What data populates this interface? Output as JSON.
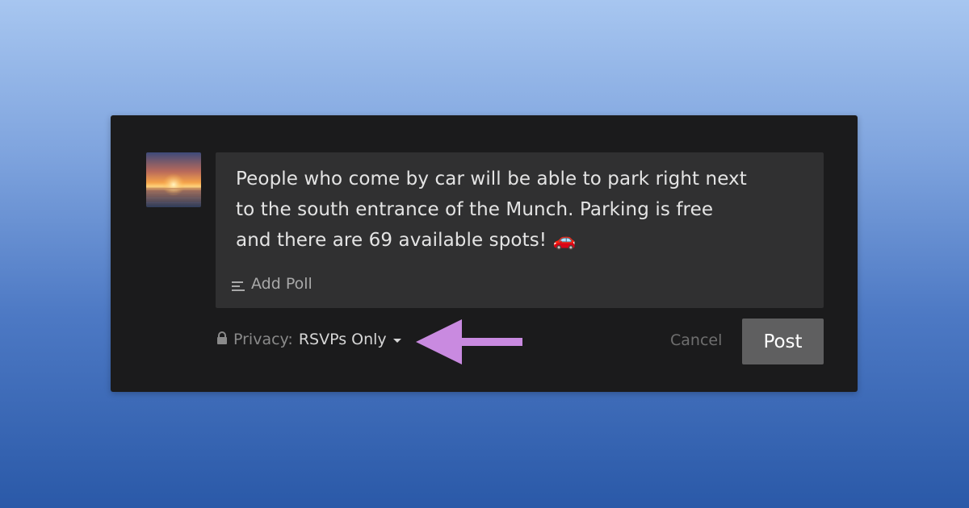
{
  "composer": {
    "avatar_icon": "sunset-avatar",
    "message": "People who come by car will be able to park right next\nto the south entrance of the Munch. Parking is free\nand there are 69 available spots! 🚗",
    "add_poll_label": "Add Poll",
    "add_poll_icon": "poll-icon"
  },
  "footer": {
    "privacy_icon": "lock-icon",
    "privacy_label": "Privacy:",
    "privacy_value": "RSVPs Only",
    "privacy_caret_icon": "caret-down-icon",
    "cancel_label": "Cancel",
    "post_label": "Post"
  },
  "annotation": {
    "arrow_icon": "arrow-left-icon",
    "arrow_color": "#c98ae0"
  },
  "colors": {
    "card_background": "#1b1b1c",
    "input_background": "#303031",
    "post_button": "#5f5f60"
  }
}
